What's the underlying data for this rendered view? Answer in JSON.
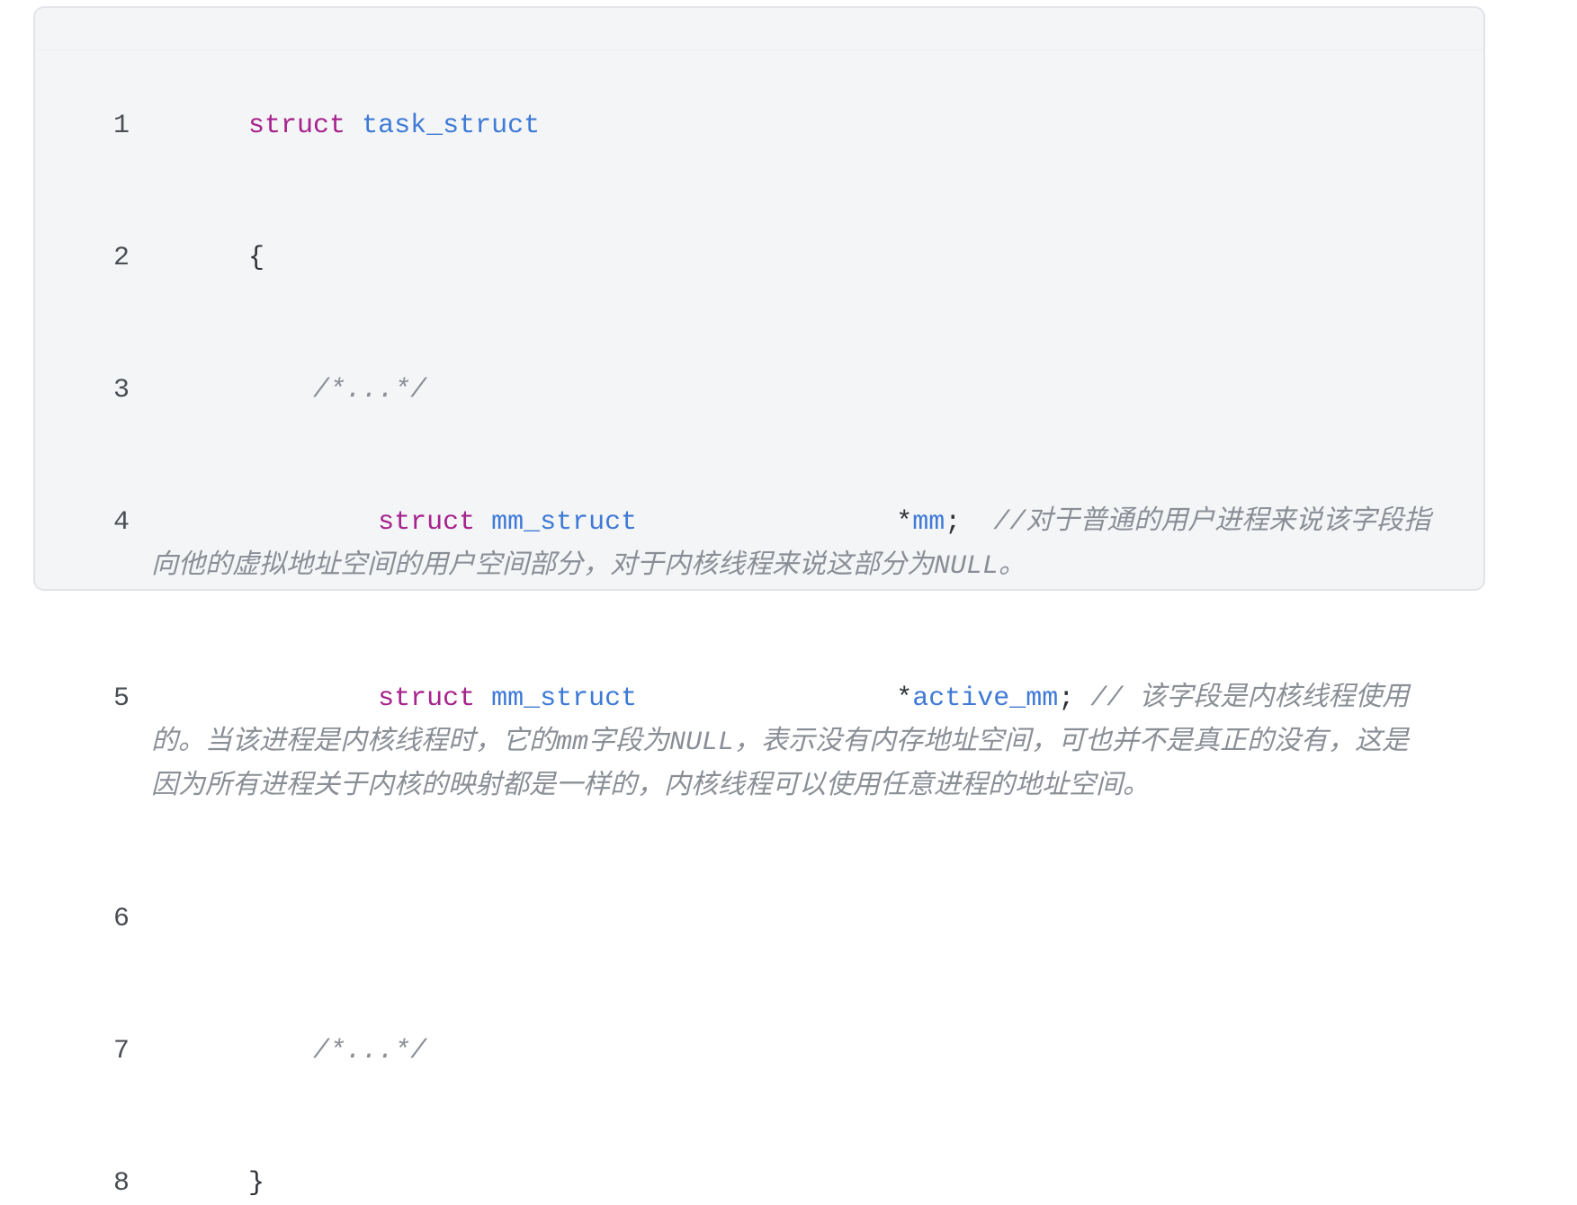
{
  "code": {
    "line_numbers": [
      "1",
      "2",
      "3",
      "4",
      "5",
      "6",
      "7",
      "8"
    ],
    "line1": {
      "keyword": "struct",
      "name": "task_struct"
    },
    "line2": {
      "text": "{"
    },
    "line3": {
      "indent": "    ",
      "comment": "/*...*/"
    },
    "line4": {
      "indent": "        ",
      "keyword": "struct",
      "type": "mm_struct",
      "gap": "                ",
      "star": "*",
      "field": "mm",
      "semi": ";",
      "space": "  ",
      "comment": "//对于普通的用户进程来说该字段指向他的虚拟地址空间的用户空间部分，对于内核线程来说这部分为NULL。"
    },
    "line5": {
      "indent": "        ",
      "keyword": "struct",
      "type": "mm_struct",
      "gap": "                ",
      "star": "*",
      "field": "active_mm",
      "semi": ";",
      "space": " ",
      "comment": "// 该字段是内核线程使用的。当该进程是内核线程时，它的mm字段为NULL，表示没有内存地址空间，可也并不是真正的没有，这是因为所有进程关于内核的映射都是一样的，内核线程可以使用任意进程的地址空间。"
    },
    "line7": {
      "indent": "    ",
      "comment": "/*...*/"
    },
    "line8": {
      "text": "}"
    }
  },
  "colors": {
    "background": "#f4f5f7",
    "keyword": "#a6238c",
    "type": "#3e7ad6",
    "comment": "#8a8f96",
    "text": "#2f3337"
  }
}
